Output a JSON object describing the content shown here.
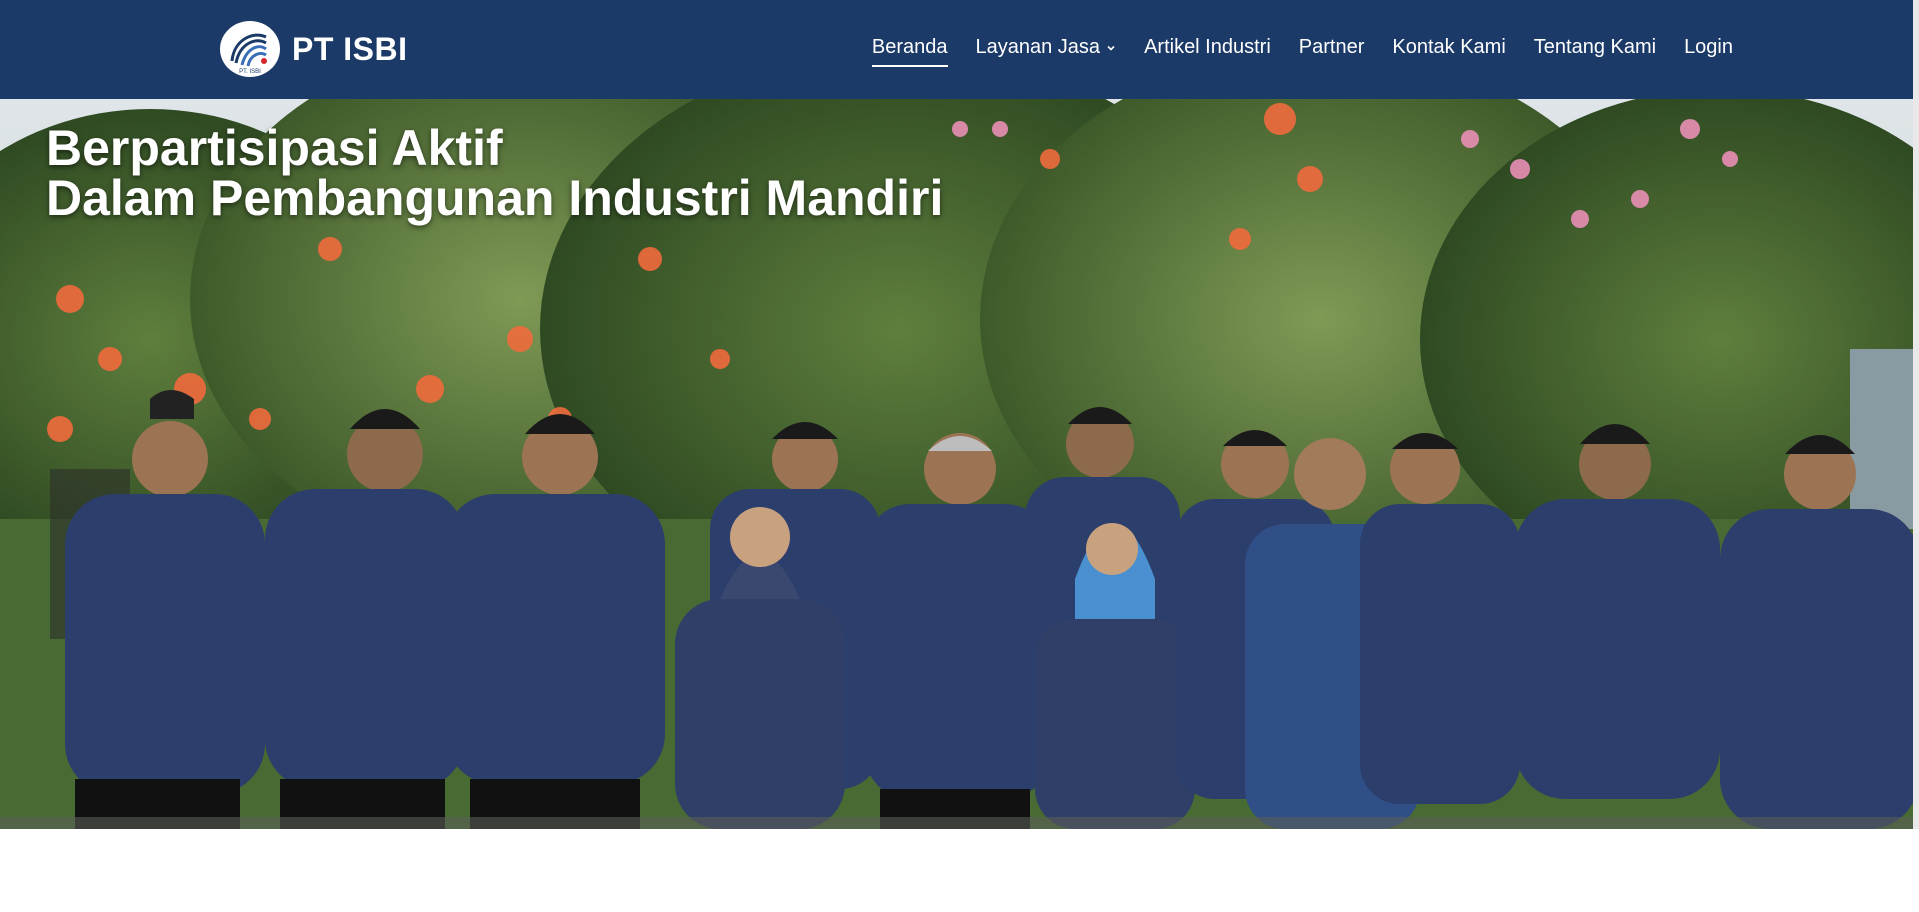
{
  "brand": {
    "name": "PT ISBI",
    "logo_caption": "PT. ISBI",
    "logo_icon": "isbi-logo-icon"
  },
  "nav": {
    "items": [
      {
        "label": "Beranda",
        "active": true
      },
      {
        "label": "Layanan Jasa",
        "has_dropdown": true
      },
      {
        "label": "Artikel Industri"
      },
      {
        "label": "Partner"
      },
      {
        "label": "Kontak Kami"
      },
      {
        "label": "Tentang Kami"
      },
      {
        "label": "Login"
      }
    ]
  },
  "hero": {
    "title_line1": "Berpartisipasi Aktif",
    "title_line2": "Dalam Pembangunan Industri Mandiri",
    "image": "team-photo-garden"
  },
  "colors": {
    "navbar": "#1b3a68",
    "uniform": "#2c3e6b",
    "accent_red": "#c0392b"
  }
}
